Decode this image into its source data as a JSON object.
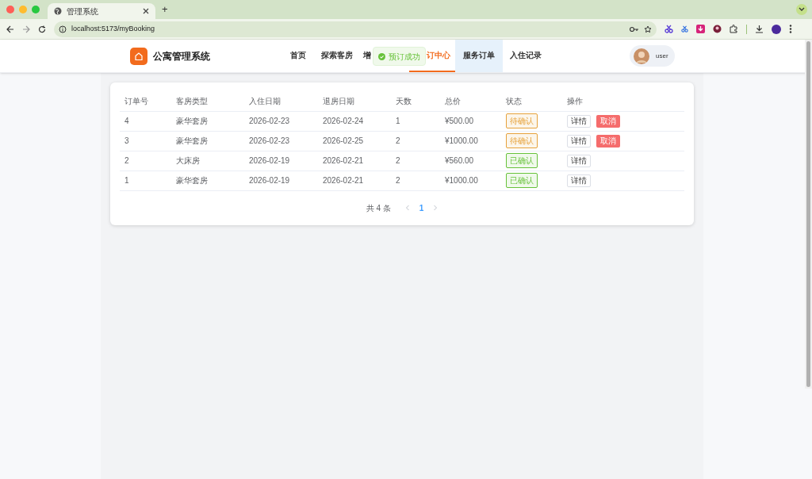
{
  "browser": {
    "tab_title": "管理系统",
    "new_tab": "+",
    "url": "localhost:5173/myBooking"
  },
  "app": {
    "logo_title": "公寓管理系统",
    "user": "user"
  },
  "nav": [
    {
      "label": "首页",
      "selected": false,
      "hovered": false
    },
    {
      "label": "探索客房",
      "selected": false,
      "hovered": false
    },
    {
      "label": "增",
      "selected": false,
      "hovered": false
    },
    {
      "label": "订中心",
      "selected": true,
      "hovered": false
    },
    {
      "label": "服务订单",
      "selected": false,
      "hovered": true
    },
    {
      "label": "入住记录",
      "selected": false,
      "hovered": false
    }
  ],
  "toast": {
    "text": "预订成功"
  },
  "table": {
    "columns": [
      "订单号",
      "客房类型",
      "入住日期",
      "退房日期",
      "天数",
      "总价",
      "状态",
      "操作"
    ],
    "rows": [
      {
        "id": "4",
        "room": "豪华套房",
        "checkin": "2026-02-23",
        "checkout": "2026-02-24",
        "days": "1",
        "price": "¥500.00",
        "status": "待确认",
        "color": "#e6a23c",
        "actions": [
          "详情",
          "取消"
        ]
      },
      {
        "id": "3",
        "room": "豪华套房",
        "checkin": "2026-02-23",
        "checkout": "2026-02-25",
        "days": "2",
        "price": "¥1000.00",
        "status": "待确认",
        "color": "#e6a23c",
        "actions": [
          "详情",
          "取消"
        ]
      },
      {
        "id": "2",
        "room": "大床房",
        "checkin": "2026-02-19",
        "checkout": "2026-02-21",
        "days": "2",
        "price": "¥560.00",
        "status": "已确认",
        "color": "#67c23a",
        "actions": [
          "详情"
        ]
      },
      {
        "id": "1",
        "room": "豪华套房",
        "checkin": "2026-02-19",
        "checkout": "2026-02-21",
        "days": "2",
        "price": "¥1000.00",
        "status": "已确认",
        "color": "#67c23a",
        "actions": [
          "详情"
        ]
      }
    ]
  },
  "pagination": {
    "total": "共 4 条",
    "pages": [
      {
        "label": "1",
        "selected": true
      }
    ]
  }
}
